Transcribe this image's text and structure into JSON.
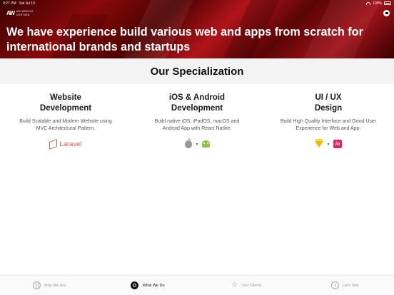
{
  "status_bar": {
    "time": "9:27 PM",
    "date": "Sat Jul 10",
    "battery": "100%"
  },
  "hero": {
    "brand_mark": "AW",
    "brand_name": "ADI WIDOYO\nCORTOEA",
    "title": "We have experience build various web and apps from scratch for international brands and startups"
  },
  "specialization": {
    "title": "Our Specialization",
    "columns": [
      {
        "shadow": "W",
        "title": "Website\nDevelopment",
        "description": "Build Scalable and Modern Website using MVC Architectural Pattern.",
        "tech": [
          "Laravel"
        ]
      },
      {
        "shadow": "i",
        "title": "iOS & Android\nDevelopment",
        "description": "Build native iOS, iPadOS, macOS and Android App with React Native.",
        "tech": [
          "apple",
          "android"
        ]
      },
      {
        "shadow": "U",
        "title": "UI / UX\nDesign",
        "description": "Build High Quality Interface and Good User Experience for Web and App.",
        "tech": [
          "sketch",
          "invision"
        ],
        "invision_glyph": "in"
      }
    ]
  },
  "tab_bar": {
    "tabs": [
      {
        "label": "Who We Are",
        "icon": "globe-icon",
        "active": false
      },
      {
        "label": "What We Do",
        "icon": "target-icon",
        "active": true
      },
      {
        "label": "Our Clients",
        "icon": "star-icon",
        "active": false
      },
      {
        "label": "Let's Talk",
        "icon": "microphone-icon",
        "active": false
      }
    ]
  }
}
